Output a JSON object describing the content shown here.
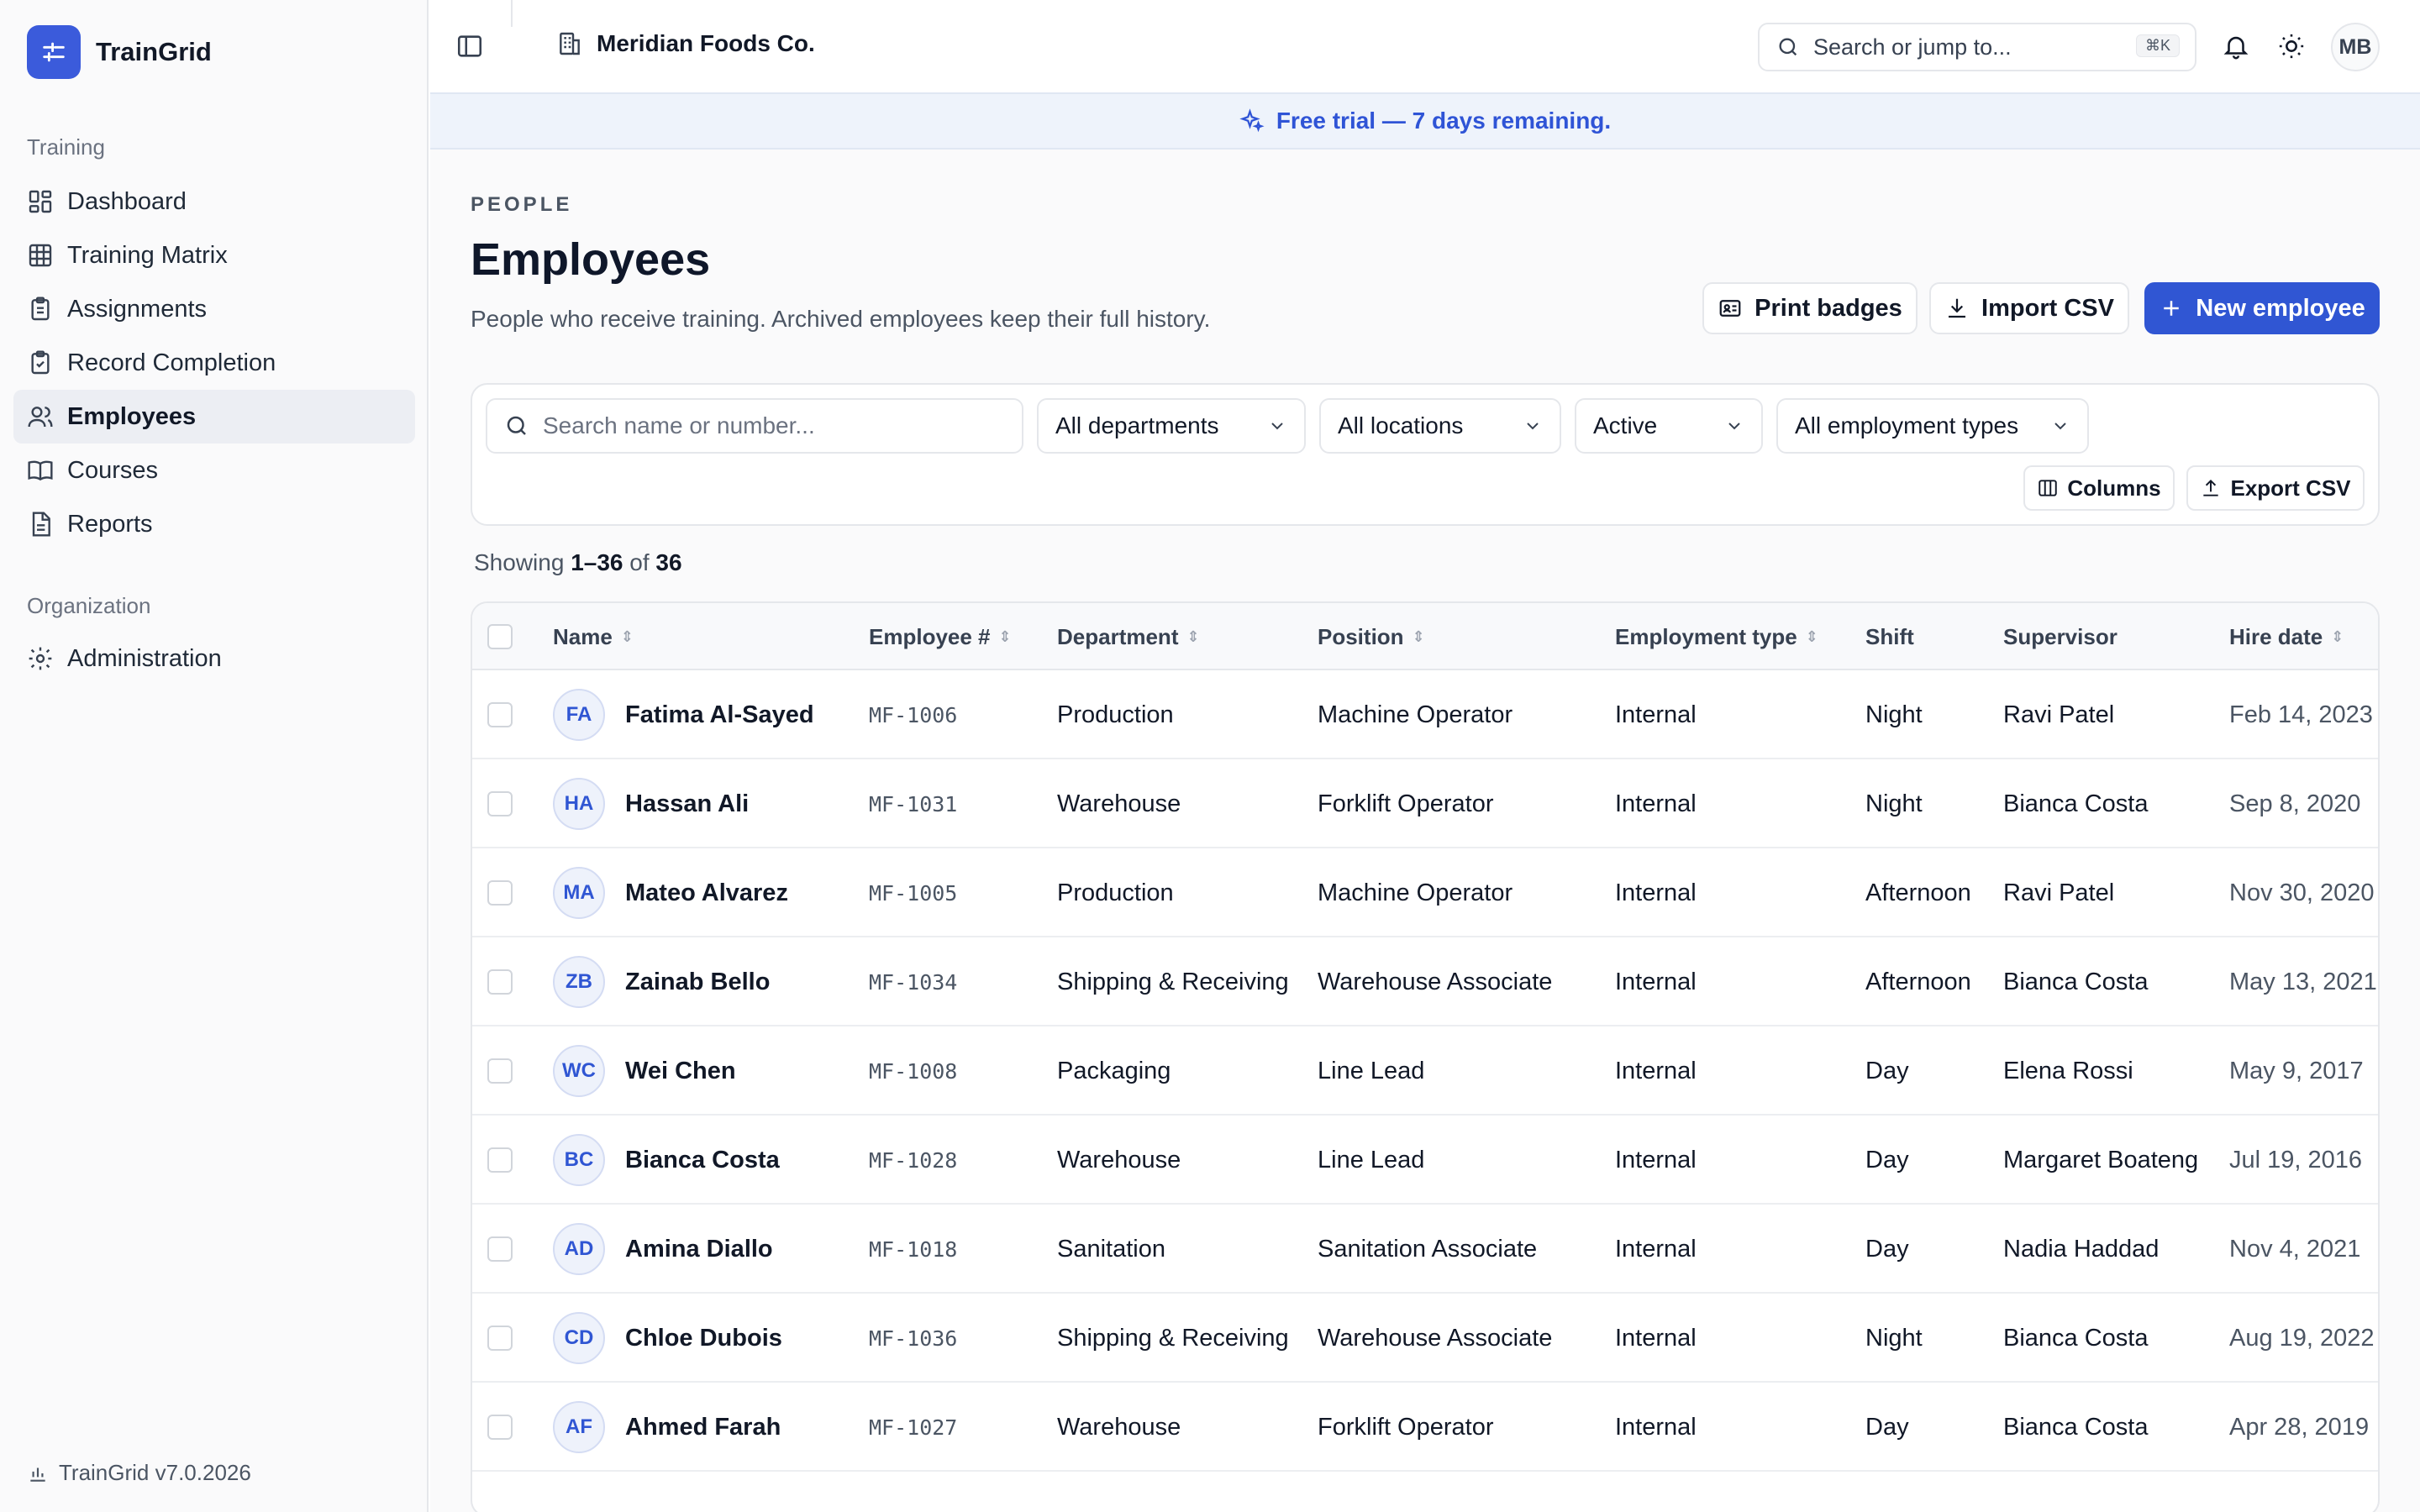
{
  "app": {
    "name": "TrainGrid",
    "version": "TrainGrid v7.0.2026"
  },
  "sidebar": {
    "training_label": "Training",
    "organization_label": "Organization",
    "items": [
      {
        "label": "Dashboard",
        "icon": "dashboard-icon"
      },
      {
        "label": "Training Matrix",
        "icon": "grid-icon"
      },
      {
        "label": "Assignments",
        "icon": "clipboard-icon"
      },
      {
        "label": "Record Completion",
        "icon": "clipboard-check-icon"
      },
      {
        "label": "Employees",
        "icon": "users-icon",
        "active": true
      },
      {
        "label": "Courses",
        "icon": "book-icon"
      },
      {
        "label": "Reports",
        "icon": "file-icon"
      },
      {
        "label": "Administration",
        "icon": "gear-icon"
      }
    ]
  },
  "topbar": {
    "org": "Meridian Foods Co.",
    "search_placeholder": "Search or jump to...",
    "shortcut": "⌘K",
    "avatar": "MB"
  },
  "banner": {
    "text": "Free trial — 7 days remaining."
  },
  "page": {
    "eyebrow": "PEOPLE",
    "title": "Employees",
    "subtitle": "People who receive training. Archived employees keep their full history.",
    "print_badges": "Print badges",
    "import_csv": "Import CSV",
    "new_employee": "New employee"
  },
  "filters": {
    "search_placeholder": "Search name or number...",
    "department": "All departments",
    "location": "All locations",
    "status": "Active",
    "employment_type": "All employment types",
    "columns": "Columns",
    "export_csv": "Export CSV"
  },
  "showing": {
    "prefix": "Showing",
    "range": "1–36",
    "of": "of",
    "total": "36"
  },
  "table": {
    "columns": [
      "Name",
      "Employee #",
      "Department",
      "Position",
      "Employment type",
      "Shift",
      "Supervisor",
      "Hire date"
    ],
    "rows": [
      {
        "initials": "FA",
        "name": "Fatima Al-Sayed",
        "number": "MF-1006",
        "department": "Production",
        "position": "Machine Operator",
        "type": "Internal",
        "shift": "Night",
        "supervisor": "Ravi Patel",
        "hire": "Feb 14, 2023"
      },
      {
        "initials": "HA",
        "name": "Hassan Ali",
        "number": "MF-1031",
        "department": "Warehouse",
        "position": "Forklift Operator",
        "type": "Internal",
        "shift": "Night",
        "supervisor": "Bianca Costa",
        "hire": "Sep 8, 2020"
      },
      {
        "initials": "MA",
        "name": "Mateo Alvarez",
        "number": "MF-1005",
        "department": "Production",
        "position": "Machine Operator",
        "type": "Internal",
        "shift": "Afternoon",
        "supervisor": "Ravi Patel",
        "hire": "Nov 30, 2020"
      },
      {
        "initials": "ZB",
        "name": "Zainab Bello",
        "number": "MF-1034",
        "department": "Shipping & Receiving",
        "position": "Warehouse Associate",
        "type": "Internal",
        "shift": "Afternoon",
        "supervisor": "Bianca Costa",
        "hire": "May 13, 2021"
      },
      {
        "initials": "WC",
        "name": "Wei Chen",
        "number": "MF-1008",
        "department": "Packaging",
        "position": "Line Lead",
        "type": "Internal",
        "shift": "Day",
        "supervisor": "Elena Rossi",
        "hire": "May 9, 2017"
      },
      {
        "initials": "BC",
        "name": "Bianca Costa",
        "number": "MF-1028",
        "department": "Warehouse",
        "position": "Line Lead",
        "type": "Internal",
        "shift": "Day",
        "supervisor": "Margaret Boateng",
        "hire": "Jul 19, 2016"
      },
      {
        "initials": "AD",
        "name": "Amina Diallo",
        "number": "MF-1018",
        "department": "Sanitation",
        "position": "Sanitation Associate",
        "type": "Internal",
        "shift": "Day",
        "supervisor": "Nadia Haddad",
        "hire": "Nov 4, 2021"
      },
      {
        "initials": "CD",
        "name": "Chloe Dubois",
        "number": "MF-1036",
        "department": "Shipping & Receiving",
        "position": "Warehouse Associate",
        "type": "Internal",
        "shift": "Night",
        "supervisor": "Bianca Costa",
        "hire": "Aug 19, 2022"
      },
      {
        "initials": "AF",
        "name": "Ahmed Farah",
        "number": "MF-1027",
        "department": "Warehouse",
        "position": "Forklift Operator",
        "type": "Internal",
        "shift": "Day",
        "supervisor": "Bianca Costa",
        "hire": "Apr 28, 2019"
      }
    ]
  }
}
